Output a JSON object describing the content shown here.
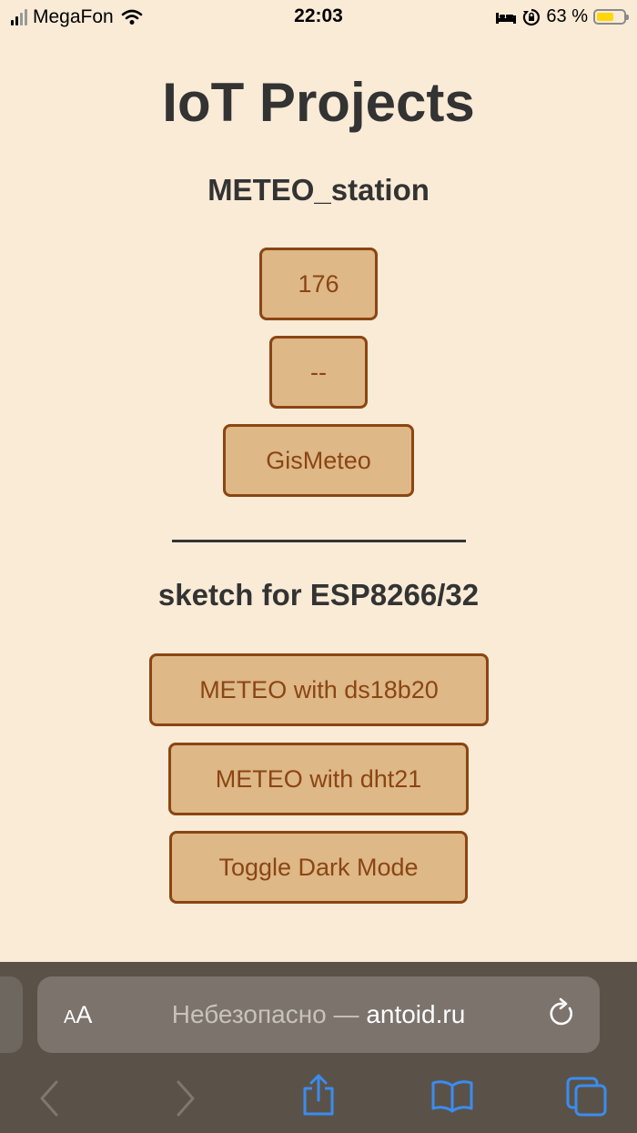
{
  "status_bar": {
    "carrier": "MegaFon",
    "time": "22:03",
    "battery_percent": "63 %",
    "battery_level": 0.63,
    "icons": [
      "signal-icon",
      "wifi-icon",
      "bed-icon",
      "orientation-lock-icon",
      "battery-icon"
    ]
  },
  "page": {
    "title": "IoT Projects",
    "section1_title": "METEO_station",
    "section1_buttons": [
      "176",
      "--",
      "GisMeteo"
    ],
    "section2_title": "sketch for ESP8266/32",
    "section2_buttons": [
      "METEO with ds18b20",
      "METEO with dht21",
      "Toggle Dark Mode"
    ]
  },
  "browser": {
    "text_size_small": "A",
    "text_size_big": "A",
    "address_insecure": "Небезопасно —",
    "address_domain": "antoid.ru",
    "toolbar_icons": [
      "back-icon",
      "forward-icon",
      "share-icon",
      "bookmarks-icon",
      "tabs-icon"
    ]
  },
  "colors": {
    "background": "#faebd7",
    "button_bg": "#deb887",
    "button_border": "#8b4513",
    "heading": "#333333",
    "accent_blue": "#3b8cf0",
    "battery": "#ffd60a"
  }
}
